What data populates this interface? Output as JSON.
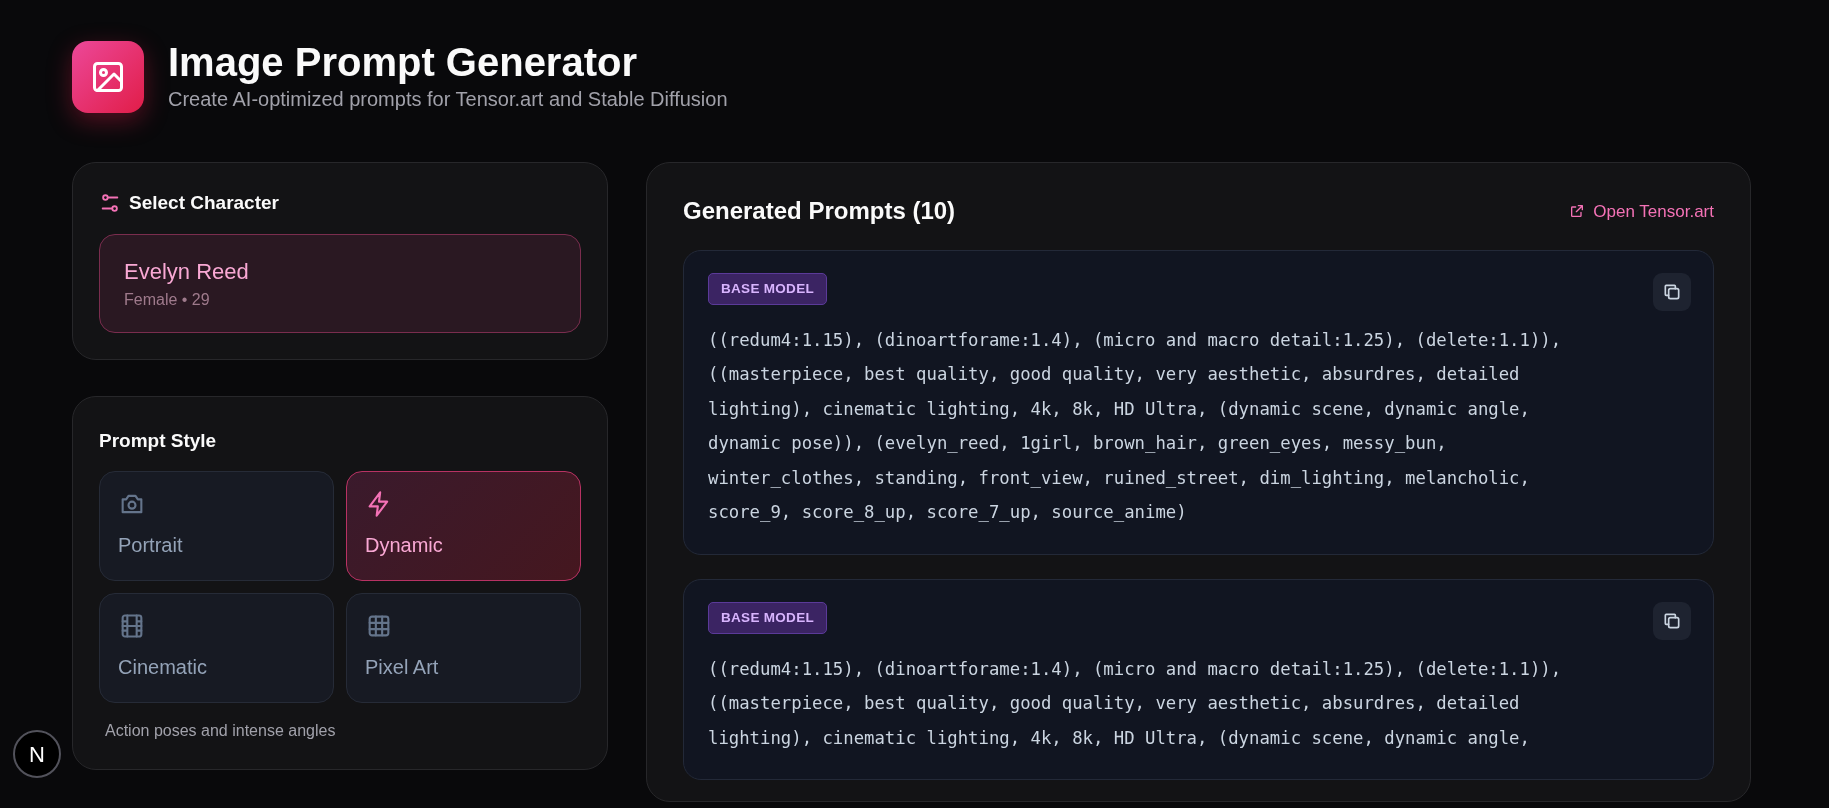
{
  "header": {
    "title": "Image Prompt Generator",
    "subtitle": "Create AI-optimized prompts for Tensor.art and Stable Diffusion"
  },
  "character_panel": {
    "title": "Select Character",
    "characters": [
      {
        "name": "Evelyn Reed",
        "details": "Female • 29",
        "selected": true
      }
    ]
  },
  "style_panel": {
    "title": "Prompt Style",
    "styles": [
      {
        "label": "Portrait",
        "kind": "camera",
        "selected": false
      },
      {
        "label": "Dynamic",
        "kind": "bolt",
        "selected": true
      },
      {
        "label": "Cinematic",
        "kind": "film",
        "selected": false
      },
      {
        "label": "Pixel Art",
        "kind": "grid",
        "selected": false
      }
    ],
    "description": "Action poses and intense angles"
  },
  "prompts_panel": {
    "title": "Generated Prompts (10)",
    "link": "Open Tensor.art",
    "prompts": [
      {
        "badge": "BASE MODEL",
        "text": "((redum4:1.15), (dinoartforame:1.4), (micro and macro detail:1.25), (delete:1.1)), ((masterpiece, best quality, good quality, very aesthetic, absurdres, detailed lighting), cinematic lighting, 4k, 8k, HD Ultra, (dynamic scene, dynamic angle, dynamic pose)), (evelyn_reed, 1girl, brown_hair, green_eyes, messy_bun, winter_clothes, standing, front_view, ruined_street, dim_lighting, melancholic, score_9, score_8_up, score_7_up, source_anime)"
      },
      {
        "badge": "BASE MODEL",
        "text": "((redum4:1.15), (dinoartforame:1.4), (micro and macro detail:1.25), (delete:1.1)), ((masterpiece, best quality, good quality, very aesthetic, absurdres, detailed lighting), cinematic lighting, 4k, 8k, HD Ultra, (dynamic scene, dynamic angle,"
      }
    ]
  },
  "dev_badge": {
    "label": "N"
  }
}
